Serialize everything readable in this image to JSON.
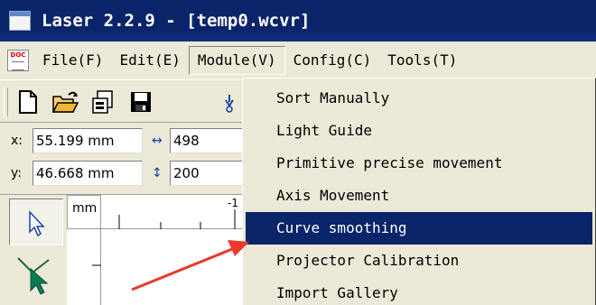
{
  "window": {
    "title": "Laser 2.2.9 - [temp0.wcvr]",
    "app_icon": "laser-app-icon"
  },
  "menubar": {
    "doc_icon_label": "DOC",
    "items": [
      {
        "label": "File(F)"
      },
      {
        "label": "Edit(E)"
      },
      {
        "label": "Module(V)"
      },
      {
        "label": "Config(C)"
      },
      {
        "label": "Tools(T)"
      }
    ],
    "open_menu": "Module(V)"
  },
  "toolbar": {
    "icons": [
      "new-file-icon",
      "open-folder-icon",
      "import-icon",
      "save-icon"
    ]
  },
  "coords": {
    "x_label": "x:",
    "x_value": "55.199 mm",
    "y_label": "y:",
    "y_value": "46.668 mm",
    "width_value": "498",
    "height_value": "200"
  },
  "ruler": {
    "unit": "mm",
    "top_tick_label": "-1"
  },
  "module_menu": {
    "items": [
      {
        "label": "Sort Manually"
      },
      {
        "label": "Light Guide"
      },
      {
        "label": "Primitive precise movement"
      },
      {
        "label": "Axis Movement"
      },
      {
        "label": "Curve smoothing"
      },
      {
        "label": "Projector Calibration"
      },
      {
        "label": "Import Gallery"
      }
    ],
    "highlighted": "Curve smoothing"
  },
  "colors": {
    "titlebar": "#0a246a",
    "highlight": "#0a246a",
    "menu_bg": "#ece9d8",
    "annotation_arrow": "#e8392b"
  }
}
